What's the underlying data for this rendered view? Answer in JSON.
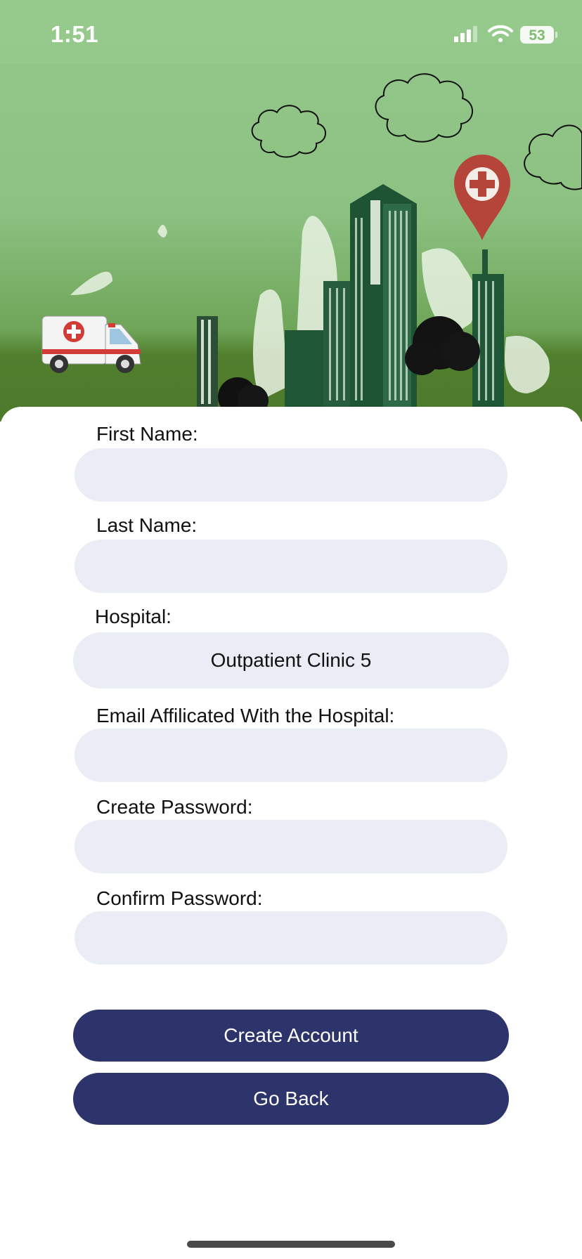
{
  "status_bar": {
    "time": "1:51",
    "battery_level": "53",
    "icons": [
      "cellular-signal-icon",
      "wifi-icon",
      "battery-icon"
    ]
  },
  "header_illustration": {
    "elements": [
      "clouds",
      "city-skyline",
      "ambulance",
      "medical-location-pin"
    ],
    "colors": {
      "sky": "#93c78a",
      "grass": "#4e7d2d",
      "pin": "#b5443a",
      "buildings": "#1e5434"
    }
  },
  "form": {
    "first_name": {
      "label": "First Name:",
      "value": ""
    },
    "last_name": {
      "label": "Last Name:",
      "value": ""
    },
    "hospital": {
      "label": "Hospital:",
      "value": "Outpatient Clinic 5"
    },
    "email": {
      "label": "Email Affilicated With the Hospital:",
      "value": ""
    },
    "password": {
      "label": "Create Password:",
      "value": ""
    },
    "confirm_password": {
      "label": "Confirm Password:",
      "value": ""
    }
  },
  "buttons": {
    "create_account": "Create Account",
    "go_back": "Go Back"
  },
  "colors": {
    "field_background": "#eaedf5",
    "button_background": "#2c346b",
    "button_text": "#ffffff"
  }
}
